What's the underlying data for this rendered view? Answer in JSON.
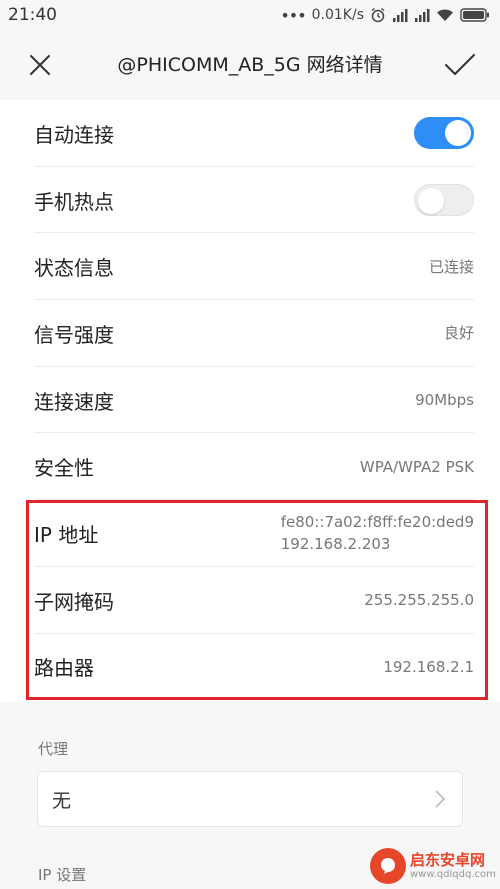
{
  "status_bar": {
    "time": "21:40",
    "network_speed": "0.01K/s",
    "dots": "•••",
    "icons": [
      "alarm-icon",
      "signal-icon",
      "signal-icon",
      "wifi-icon",
      "battery-icon"
    ]
  },
  "header": {
    "title": "@PHICOMM_AB_5G  网络详情",
    "close_icon": "close-icon",
    "confirm_icon": "check-icon"
  },
  "rows": [
    {
      "label": "自动连接",
      "type": "toggle",
      "on": true
    },
    {
      "label": "手机热点",
      "type": "toggle",
      "on": false
    },
    {
      "label": "状态信息",
      "value": "已连接"
    },
    {
      "label": "信号强度",
      "value": "良好"
    },
    {
      "label": "连接速度",
      "value": "90Mbps"
    },
    {
      "label": "安全性",
      "value": "WPA/WPA2 PSK"
    },
    {
      "label": "IP 地址",
      "value": "fe80::7a02:f8ff:fe20:ded9",
      "value2": "192.168.2.203"
    },
    {
      "label": "子网掩码",
      "value": "255.255.255.0"
    },
    {
      "label": "路由器",
      "value": "192.168.2.1"
    }
  ],
  "proxy": {
    "section_label": "代理",
    "value": "无"
  },
  "ip_settings": {
    "section_label": "IP 设置"
  },
  "watermark": {
    "main": "启东安卓网",
    "sub": "www.qdlqdq.com"
  },
  "colors": {
    "accent": "#2f8ef5",
    "highlight": "#e0262b",
    "watermark": "#e8462a"
  }
}
